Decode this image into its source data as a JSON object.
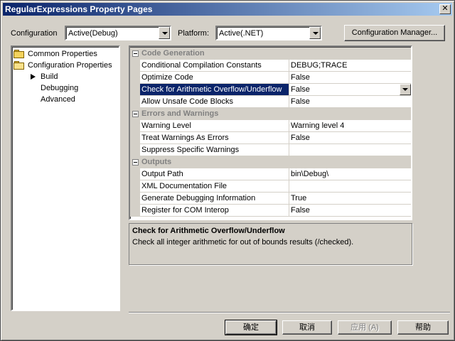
{
  "window": {
    "title": "RegularExpressions Property Pages",
    "close_glyph": "✕"
  },
  "toolbar": {
    "configuration_label": "Configuration",
    "configuration_value": "Active(Debug)",
    "platform_label": "Platform:",
    "platform_value": "Active(.NET)",
    "config_manager_label": "Configuration Manager..."
  },
  "tree": {
    "common": "Common Properties",
    "configuration": "Configuration Properties",
    "build": "Build",
    "debugging": "Debugging",
    "advanced": "Advanced"
  },
  "grid": {
    "code_generation": {
      "title": "Code Generation",
      "rows": [
        {
          "name": "Conditional Compilation Constants",
          "value": "DEBUG;TRACE"
        },
        {
          "name": "Optimize Code",
          "value": "False"
        },
        {
          "name": "Check for Arithmetic Overflow/Underflow",
          "value": "False"
        },
        {
          "name": "Allow Unsafe Code Blocks",
          "value": "False"
        }
      ]
    },
    "errors": {
      "title": "Errors and Warnings",
      "rows": [
        {
          "name": "Warning Level",
          "value": "Warning level 4"
        },
        {
          "name": "Treat Warnings As Errors",
          "value": "False"
        },
        {
          "name": "Suppress Specific Warnings",
          "value": ""
        }
      ]
    },
    "outputs": {
      "title": "Outputs",
      "rows": [
        {
          "name": "Output Path",
          "value": "bin\\Debug\\"
        },
        {
          "name": "XML Documentation File",
          "value": ""
        },
        {
          "name": "Generate Debugging Information",
          "value": "True"
        },
        {
          "name": "Register for COM Interop",
          "value": "False"
        }
      ]
    }
  },
  "description": {
    "title": "Check for Arithmetic Overflow/Underflow",
    "text": "Check all integer arithmetic for out of bounds results (/checked)."
  },
  "buttons": {
    "ok": "确定",
    "cancel": "取消",
    "apply": "应用 (A)",
    "help": "帮助"
  },
  "colors": {
    "selection": "#0a246a",
    "face": "#d4d0c8"
  }
}
